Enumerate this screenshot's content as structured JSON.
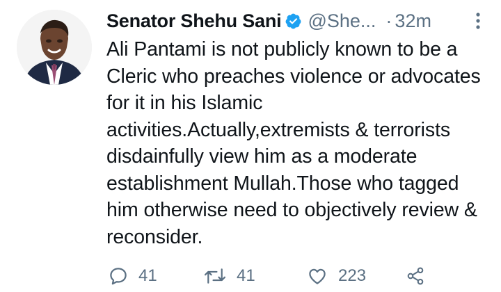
{
  "tweet": {
    "display_name": "Senator Shehu Sani",
    "handle": "@She...",
    "separator": "·",
    "timestamp": "32m",
    "verified": true,
    "text": "Ali Pantami is not publicly known to be a Cleric who preaches violence or advocates for it in his Islamic activities.Actually,extremists & terrorists disdainfully view him as a moderate establishment Mullah.Those who tagged him otherwise need to objectively review & reconsider."
  },
  "actions": {
    "reply_count": "41",
    "retweet_count": "41",
    "like_count": "223"
  },
  "icons": {
    "verified": "verified-badge-icon",
    "more": "more-vertical-icon",
    "reply": "reply-icon",
    "retweet": "retweet-icon",
    "like": "heart-icon",
    "share": "share-icon"
  },
  "colors": {
    "verified_blue": "#1da1f2",
    "text_primary": "#0f1419",
    "text_secondary": "#5b7083"
  }
}
